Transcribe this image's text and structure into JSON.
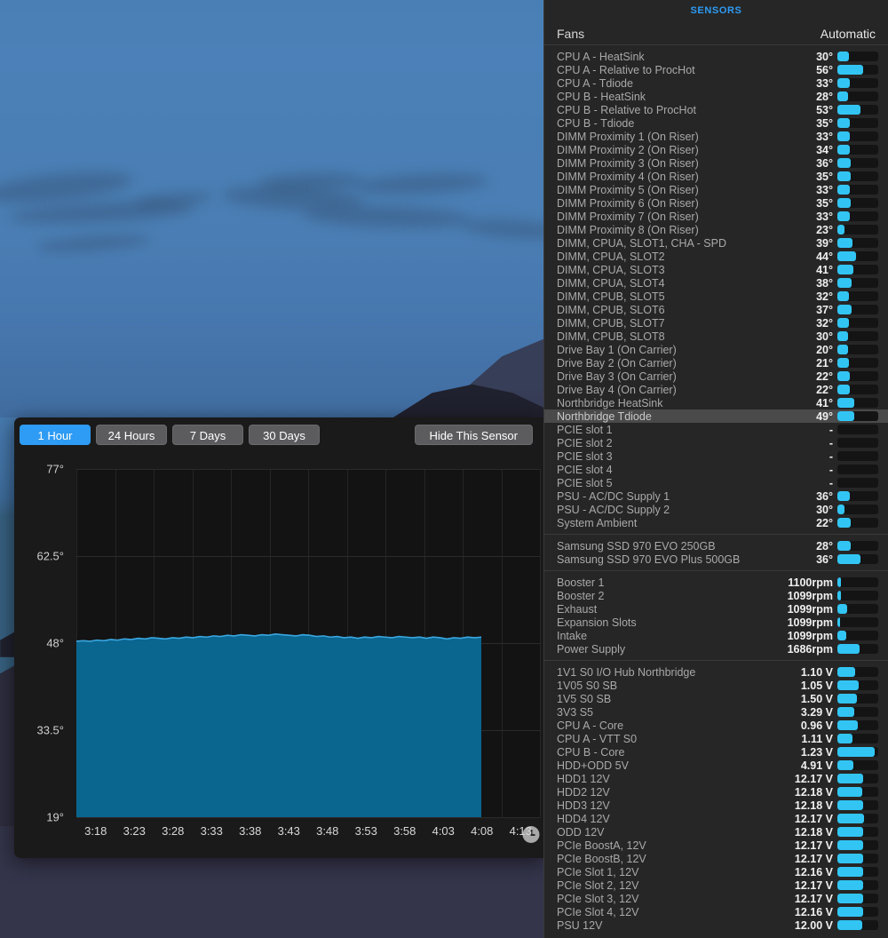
{
  "panel": {
    "title": "SENSORS",
    "header": {
      "label": "Fans",
      "value": "Automatic"
    },
    "accent_color": "#2e9bf4",
    "bar_color": "#32c5f4",
    "groups": [
      {
        "name": "temperatures",
        "rows": [
          {
            "name": "CPU A - HeatSink",
            "value": "30°",
            "bar": 28
          },
          {
            "name": "CPU A - Relative to ProcHot",
            "value": "56°",
            "bar": 62
          },
          {
            "name": "CPU A - Tdiode",
            "value": "33°",
            "bar": 30
          },
          {
            "name": "CPU B - HeatSink",
            "value": "28°",
            "bar": 26
          },
          {
            "name": "CPU B - Relative to ProcHot",
            "value": "53°",
            "bar": 56
          },
          {
            "name": "CPU B - Tdiode",
            "value": "35°",
            "bar": 31
          },
          {
            "name": "DIMM Proximity 1 (On Riser)",
            "value": "33°",
            "bar": 30
          },
          {
            "name": "DIMM Proximity 2 (On Riser)",
            "value": "34°",
            "bar": 31
          },
          {
            "name": "DIMM Proximity 3 (On Riser)",
            "value": "36°",
            "bar": 33
          },
          {
            "name": "DIMM Proximity 4 (On Riser)",
            "value": "35°",
            "bar": 32
          },
          {
            "name": "DIMM Proximity 5 (On Riser)",
            "value": "33°",
            "bar": 30
          },
          {
            "name": "DIMM Proximity 6 (On Riser)",
            "value": "35°",
            "bar": 33
          },
          {
            "name": "DIMM Proximity 7 (On Riser)",
            "value": "33°",
            "bar": 30
          },
          {
            "name": "DIMM Proximity 8 (On Riser)",
            "value": "23°",
            "bar": 17
          },
          {
            "name": "DIMM, CPUA, SLOT1, CHA - SPD",
            "value": "39°",
            "bar": 36
          },
          {
            "name": "DIMM, CPUA, SLOT2",
            "value": "44°",
            "bar": 45
          },
          {
            "name": "DIMM, CPUA, SLOT3",
            "value": "41°",
            "bar": 40
          },
          {
            "name": "DIMM, CPUA, SLOT4",
            "value": "38°",
            "bar": 35
          },
          {
            "name": "DIMM, CPUB, SLOT5",
            "value": "32°",
            "bar": 29
          },
          {
            "name": "DIMM, CPUB, SLOT6",
            "value": "37°",
            "bar": 34
          },
          {
            "name": "DIMM, CPUB, SLOT7",
            "value": "32°",
            "bar": 29
          },
          {
            "name": "DIMM, CPUB, SLOT8",
            "value": "30°",
            "bar": 27
          },
          {
            "name": "Drive Bay 1 (On Carrier)",
            "value": "20°",
            "bar": 26
          },
          {
            "name": "Drive Bay 2 (On Carrier)",
            "value": "21°",
            "bar": 28
          },
          {
            "name": "Drive Bay 3 (On Carrier)",
            "value": "22°",
            "bar": 30
          },
          {
            "name": "Drive Bay 4 (On Carrier)",
            "value": "22°",
            "bar": 30
          },
          {
            "name": "Northbridge HeatSink",
            "value": "41°",
            "bar": 41
          },
          {
            "name": "Northbridge Tdiode",
            "value": "49°",
            "bar": 41,
            "selected": true
          },
          {
            "name": "PCIE slot 1",
            "value": "-",
            "bar": 0
          },
          {
            "name": "PCIE slot 2",
            "value": "-",
            "bar": 0
          },
          {
            "name": "PCIE slot 3",
            "value": "-",
            "bar": 0
          },
          {
            "name": "PCIE slot 4",
            "value": "-",
            "bar": 0
          },
          {
            "name": "PCIE slot 5",
            "value": "-",
            "bar": 0
          },
          {
            "name": "PSU - AC/DC Supply 1",
            "value": "36°",
            "bar": 30
          },
          {
            "name": "PSU - AC/DC Supply 2",
            "value": "30°",
            "bar": 17
          },
          {
            "name": "System Ambient",
            "value": "22°",
            "bar": 33
          }
        ]
      },
      {
        "name": "drives",
        "rows": [
          {
            "name": "Samsung SSD 970 EVO 250GB",
            "value": "28°",
            "bar": 32
          },
          {
            "name": "Samsung SSD 970 EVO Plus 500GB",
            "value": "36°",
            "bar": 56
          }
        ]
      },
      {
        "name": "fans",
        "rows": [
          {
            "name": "Booster 1",
            "value": "1100rpm",
            "bar": 8
          },
          {
            "name": "Booster 2",
            "value": "1099rpm",
            "bar": 8
          },
          {
            "name": "Exhaust",
            "value": "1099rpm",
            "bar": 24
          },
          {
            "name": "Expansion Slots",
            "value": "1099rpm",
            "bar": 7
          },
          {
            "name": "Intake",
            "value": "1099rpm",
            "bar": 22
          },
          {
            "name": "Power Supply",
            "value": "1686rpm",
            "bar": 55
          }
        ]
      },
      {
        "name": "voltages",
        "rows": [
          {
            "name": "1V1 S0 I/O Hub Northbridge",
            "value": "1.10 V",
            "bar": 44
          },
          {
            "name": "1V05 S0 SB",
            "value": "1.05 V",
            "bar": 53
          },
          {
            "name": "1V5 S0 SB",
            "value": "1.50 V",
            "bar": 48
          },
          {
            "name": "3V3 S5",
            "value": "3.29 V",
            "bar": 42
          },
          {
            "name": "CPU A - Core",
            "value": "0.96 V",
            "bar": 51
          },
          {
            "name": "CPU A - VTT S0",
            "value": "1.11 V",
            "bar": 36
          },
          {
            "name": "CPU B - Core",
            "value": "1.23 V",
            "bar": 92
          },
          {
            "name": "HDD+ODD 5V",
            "value": "4.91 V",
            "bar": 40
          },
          {
            "name": "HDD1 12V",
            "value": "12.17 V",
            "bar": 63
          },
          {
            "name": "HDD2 12V",
            "value": "12.18 V",
            "bar": 60
          },
          {
            "name": "HDD3 12V",
            "value": "12.18 V",
            "bar": 62
          },
          {
            "name": "HDD4 12V",
            "value": "12.17 V",
            "bar": 65
          },
          {
            "name": "ODD 12V",
            "value": "12.18 V",
            "bar": 62
          },
          {
            "name": "PCIe BoostA, 12V",
            "value": "12.17 V",
            "bar": 63
          },
          {
            "name": "PCIe BoostB, 12V",
            "value": "12.17 V",
            "bar": 63
          },
          {
            "name": "PCIe Slot 1, 12V",
            "value": "12.16 V",
            "bar": 64
          },
          {
            "name": "PCIe Slot 2, 12V",
            "value": "12.17 V",
            "bar": 63
          },
          {
            "name": "PCIe Slot 3, 12V",
            "value": "12.17 V",
            "bar": 64
          },
          {
            "name": "PCIe Slot 4, 12V",
            "value": "12.16 V",
            "bar": 63
          },
          {
            "name": "PSU 12V",
            "value": "12.00 V",
            "bar": 60
          }
        ]
      }
    ]
  },
  "graph": {
    "ranges": [
      {
        "label": "1 Hour",
        "active": true
      },
      {
        "label": "24 Hours",
        "active": false
      },
      {
        "label": "7 Days",
        "active": false
      },
      {
        "label": "30 Days",
        "active": false
      }
    ],
    "hide_sensor_label": "Hide This Sensor",
    "clock_icon": "clock-icon"
  },
  "chart_data": {
    "type": "area",
    "title": "Northbridge Tdiode",
    "xlabel": "",
    "ylabel": "",
    "ylim": [
      19,
      77
    ],
    "yticks": [
      "19°",
      "33.5°",
      "48°",
      "62.5°",
      "77°"
    ],
    "ytick_values": [
      19,
      33.5,
      48,
      62.5,
      77
    ],
    "xticks": [
      "3:18",
      "3:23",
      "3:28",
      "3:33",
      "3:38",
      "3:43",
      "3:48",
      "3:53",
      "3:58",
      "4:03",
      "4:08",
      "4:13"
    ],
    "grid": true,
    "legend": "none",
    "series": [
      {
        "name": "Northbridge Tdiode",
        "unit": "°",
        "fill_color": "#0a658f",
        "line_color": "#3aa7e0",
        "values": [
          48.3,
          48.4,
          48.3,
          48.5,
          48.4,
          48.6,
          48.5,
          48.7,
          48.6,
          48.8,
          48.7,
          48.9,
          48.8,
          48.7,
          48.9,
          48.8,
          49.0,
          48.9,
          49.1,
          49.0,
          49.2,
          49.1,
          49.3,
          49.2,
          49.4,
          49.3,
          49.2,
          49.4,
          49.3,
          49.5,
          49.4,
          49.3,
          49.2,
          49.4,
          49.3,
          49.1,
          49.2,
          49.0,
          49.1,
          48.9,
          49.0,
          48.8,
          49.0,
          48.9,
          49.1,
          49.0,
          48.9,
          49.1,
          49.0,
          48.9,
          49.0,
          48.8,
          49.0,
          48.9,
          48.7,
          48.9,
          48.8,
          49.0,
          48.9,
          49.0
        ]
      }
    ]
  }
}
